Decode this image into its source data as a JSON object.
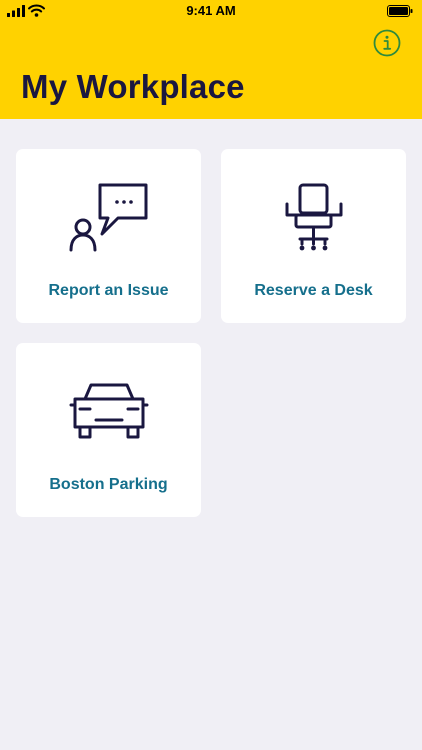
{
  "status_bar": {
    "time": "9:41 AM"
  },
  "header": {
    "title": "My Workplace",
    "info_icon": "info-circle-icon",
    "background_color": "#ffd200",
    "title_color": "#1a1740",
    "info_color": "#2f8a3d"
  },
  "tiles": [
    {
      "label": "Report an Issue",
      "icon": "person-speech-bubble-icon"
    },
    {
      "label": "Reserve a Desk",
      "icon": "office-chair-icon"
    },
    {
      "label": "Boston Parking",
      "icon": "car-icon"
    }
  ],
  "colors": {
    "page_background": "#f0eff5",
    "tile_background": "#ffffff",
    "tile_label": "#156f8c",
    "icon_stroke": "#1a1740"
  }
}
